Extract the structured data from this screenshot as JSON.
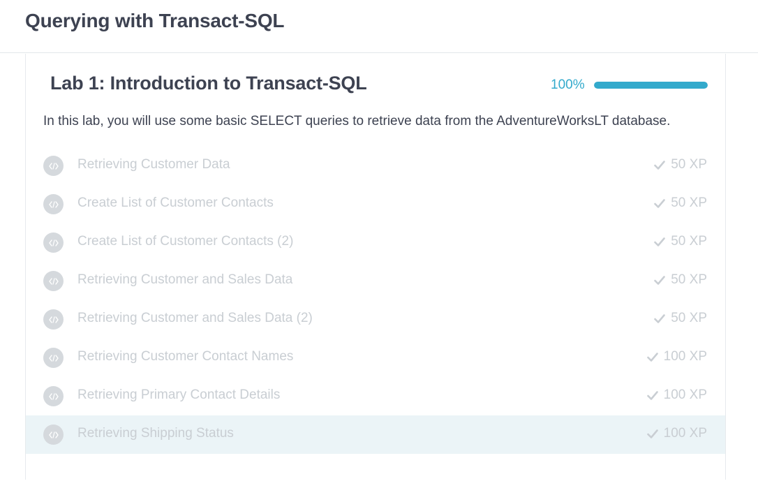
{
  "course": {
    "title": "Querying with Transact-SQL"
  },
  "chapter": {
    "title": "Lab 1: Introduction to Transact-SQL",
    "progress_label": "100%",
    "progress_fraction": 1.0,
    "description": "In this lab, you will use some basic SELECT queries to retrieve data from the AdventureWorksLT database.",
    "exercises": [
      {
        "title": "Retrieving Customer Data",
        "xp": "50 XP",
        "icon": "code-icon",
        "completed": true
      },
      {
        "title": "Create List of Customer Contacts",
        "xp": "50 XP",
        "icon": "code-icon",
        "completed": true
      },
      {
        "title": "Create List of Customer Contacts (2)",
        "xp": "50 XP",
        "icon": "code-icon",
        "completed": true
      },
      {
        "title": "Retrieving Customer and Sales Data",
        "xp": "50 XP",
        "icon": "code-icon",
        "completed": true
      },
      {
        "title": "Retrieving Customer and Sales Data (2)",
        "xp": "50 XP",
        "icon": "code-icon",
        "completed": true
      },
      {
        "title": "Retrieving Customer Contact Names",
        "xp": "100 XP",
        "icon": "code-icon",
        "completed": true
      },
      {
        "title": "Retrieving Primary Contact Details",
        "xp": "100 XP",
        "icon": "code-icon",
        "completed": true
      },
      {
        "title": "Retrieving Shipping Status",
        "xp": "100 XP",
        "icon": "code-icon",
        "completed": true
      }
    ]
  },
  "colors": {
    "accent": "#33aacc",
    "text_dark": "#3d4251",
    "text_muted": "#c9ced3",
    "highlight_row": "#ebf4f7"
  }
}
